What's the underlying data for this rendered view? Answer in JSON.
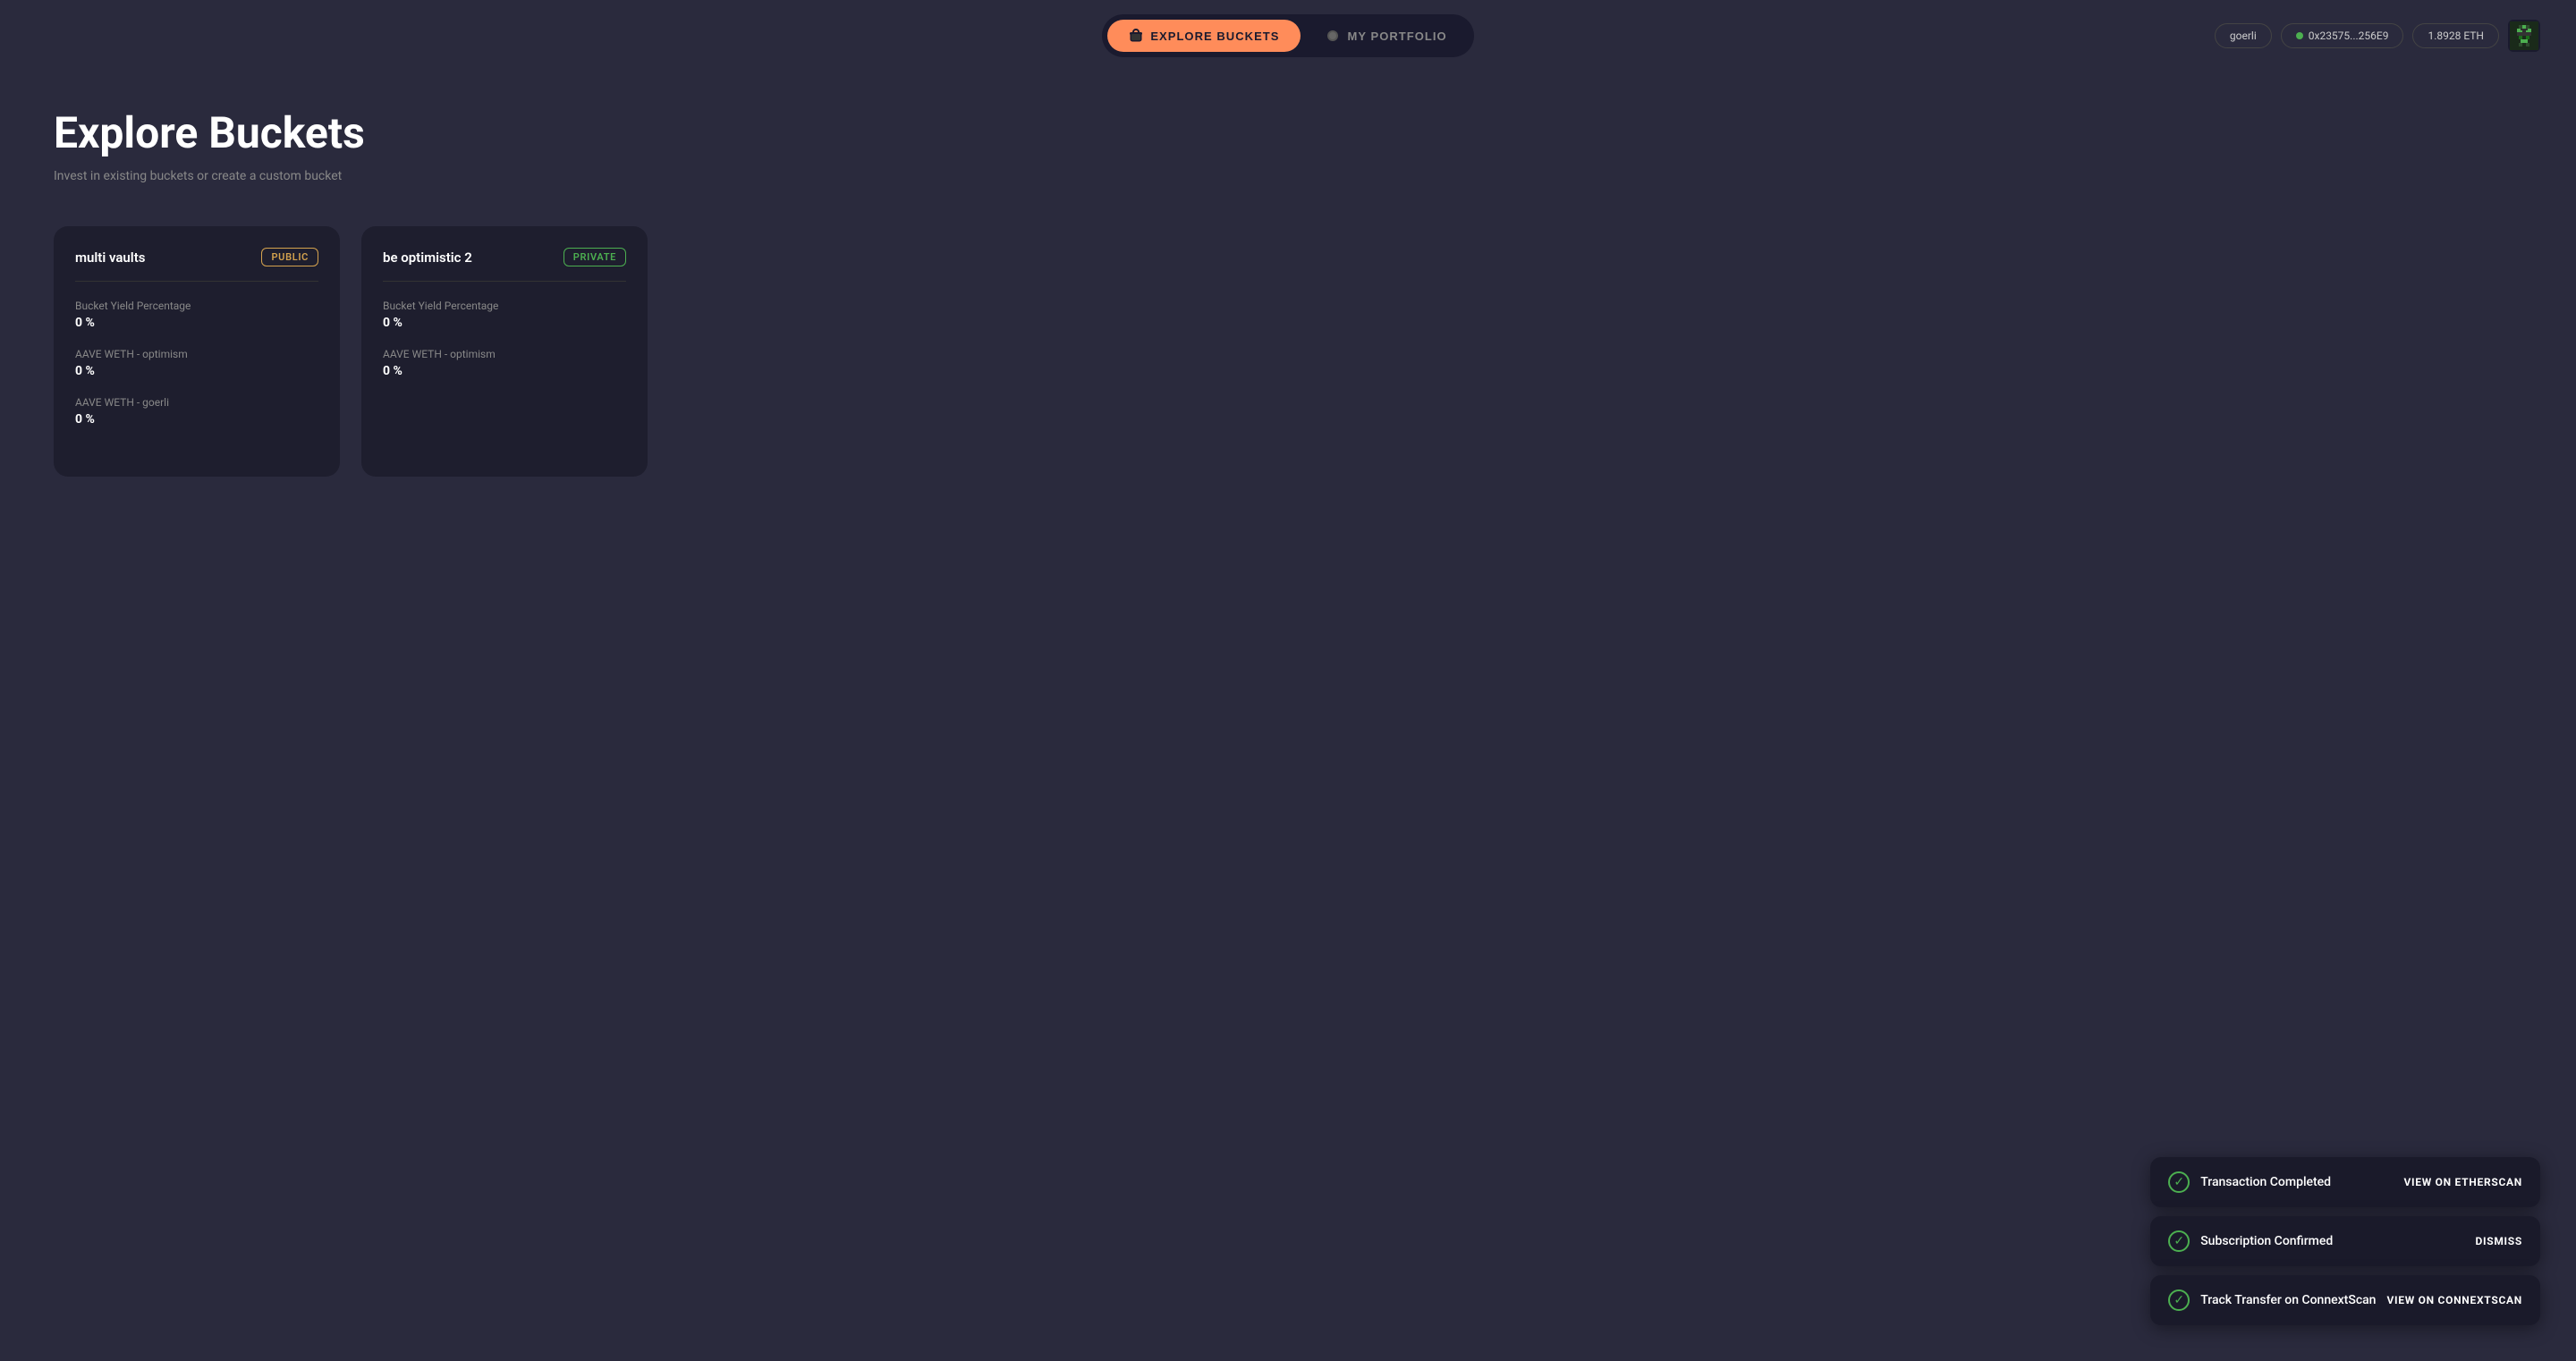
{
  "header": {
    "nav": {
      "explore_label": "EXPLORE BUCKETS",
      "portfolio_label": "MY PORTFOLIO"
    },
    "network_label": "goerli",
    "address_label": "0x23575...256E9",
    "eth_balance": "1.8928 ETH"
  },
  "page": {
    "title": "Explore Buckets",
    "subtitle": "Invest in existing buckets or create a custom bucket"
  },
  "cards": [
    {
      "id": "multi-vaults",
      "title": "multi vaults",
      "badge": "PUBLIC",
      "badge_type": "public",
      "stats": [
        {
          "label": "Bucket Yield Percentage",
          "value": "0 %"
        },
        {
          "label": "AAVE WETH - optimism",
          "value": "0 %"
        },
        {
          "label": "AAVE WETH - goerli",
          "value": "0 %"
        }
      ]
    },
    {
      "id": "be-optimistic-2",
      "title": "be optimistic 2",
      "badge": "PRIVATE",
      "badge_type": "private",
      "stats": [
        {
          "label": "Bucket Yield Percentage",
          "value": "0 %"
        },
        {
          "label": "AAVE WETH - optimism",
          "value": "0 %"
        }
      ]
    }
  ],
  "toasts": [
    {
      "id": "transaction-completed",
      "text": "Transaction Completed",
      "action": "VIEW ON ETHERSCAN"
    },
    {
      "id": "subscription-confirmed",
      "text": "Subscription Confirmed",
      "action": "DISMISS"
    },
    {
      "id": "track-transfer",
      "text": "Track Transfer on ConnextScan",
      "action": "VIEW ON CONNEXTSCAN"
    }
  ]
}
